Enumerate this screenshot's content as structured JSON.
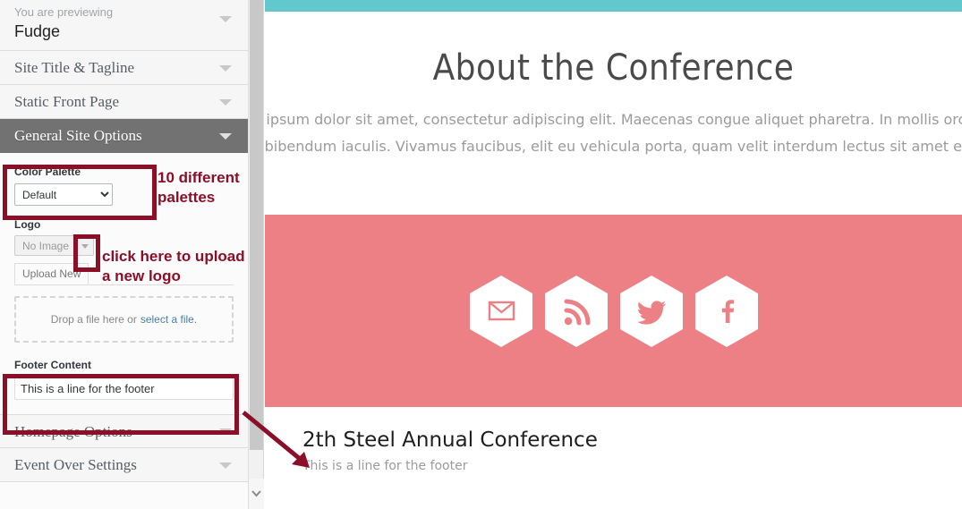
{
  "sidebar": {
    "preview_eyebrow": "You are previewing",
    "preview_title": "Fudge",
    "sections": [
      {
        "label": "Site Title & Tagline",
        "active": false
      },
      {
        "label": "Static Front Page",
        "active": false
      },
      {
        "label": "General Site Options",
        "active": true
      }
    ],
    "bottom_sections": [
      {
        "label": "Homepage Options"
      },
      {
        "label": "Event Over Settings"
      }
    ],
    "color_palette": {
      "label": "Color Palette",
      "selected": "Default",
      "options": [
        "Default"
      ]
    },
    "logo": {
      "label": "Logo",
      "button_label": "No Image",
      "tab_label": "Upload New",
      "dropzone_text": "Drop a file here or",
      "dropzone_link": "select a file."
    },
    "footer_content": {
      "label": "Footer Content",
      "value": "This is a line for the footer"
    }
  },
  "annotations": {
    "palette_note_line1": "10 different",
    "palette_note_line2": "palettes",
    "logo_note_line1": "click here to upload",
    "logo_note_line2": "a new logo",
    "box_color": "#8c0f28"
  },
  "preview": {
    "accent_top_bar": "#63c7ce",
    "band_color": "#ec8085",
    "about_title": "About the Conference",
    "about_paragraph": "Lorem ipsum dolor sit amet, consectetur adipiscing elit. Maecenas congue aliquet pharetra. In mollis orci non sem bibendum iaculis. Vivamus faucibus, elit eu vehicula porta, quam velit interdum lectus sit amet eros.",
    "social_icons": [
      {
        "name": "email-icon"
      },
      {
        "name": "rss-icon"
      },
      {
        "name": "twitter-icon"
      },
      {
        "name": "facebook-icon"
      }
    ],
    "footer_site_title": "2th Steel Annual Conference",
    "footer_tagline": "This is a line for the footer"
  }
}
